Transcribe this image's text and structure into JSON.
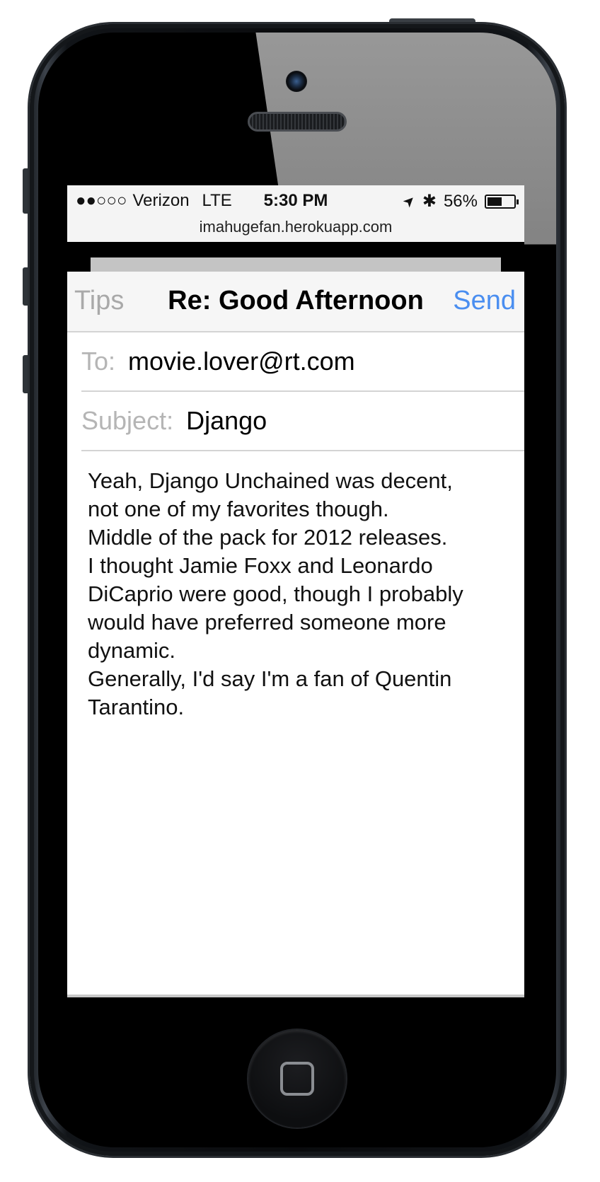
{
  "status_bar": {
    "signal": "●●○○○",
    "carrier": "Verizon",
    "network": "LTE",
    "time": "5:30 PM",
    "location_icon": "➤",
    "bluetooth_icon": "✱",
    "battery_percent": "56%",
    "battery_level": 0.56,
    "url": "imahugefan.herokuapp.com"
  },
  "nav": {
    "left_label": "Tips",
    "title": "Re: Good Afternoon",
    "right_label": "Send"
  },
  "fields": {
    "to_label": "To:",
    "to_value": "movie.lover@rt.com",
    "subject_label": "Subject:",
    "subject_value": "Django"
  },
  "body": {
    "lines": [
      "Yeah, Django Unchained was decent,",
      "not one of my favorites though.",
      "Middle of the pack for 2012 releases.",
      "I thought Jamie Foxx and Leonardo",
      "DiCaprio were good, though I probably",
      "would have preferred someone more",
      "dynamic.",
      "Generally, I'd say I'm a fan of Quentin",
      "Tarantino."
    ]
  },
  "colors": {
    "accent": "#4a8ef0",
    "label_gray": "#b5b5b5"
  }
}
